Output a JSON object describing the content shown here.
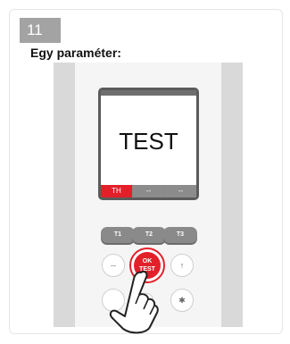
{
  "step": {
    "number": "11",
    "title": "Egy paraméter:"
  },
  "device": {
    "screen_text": "TEST",
    "tabs": [
      "TH",
      "--",
      "--"
    ],
    "top_buttons": [
      "T1",
      "T2",
      "T3"
    ],
    "ok_button": {
      "line1": "OK",
      "line2": "TEST"
    },
    "side_buttons": {
      "left_top": "--",
      "right_top": "↑",
      "right_bottom": "✱"
    }
  }
}
